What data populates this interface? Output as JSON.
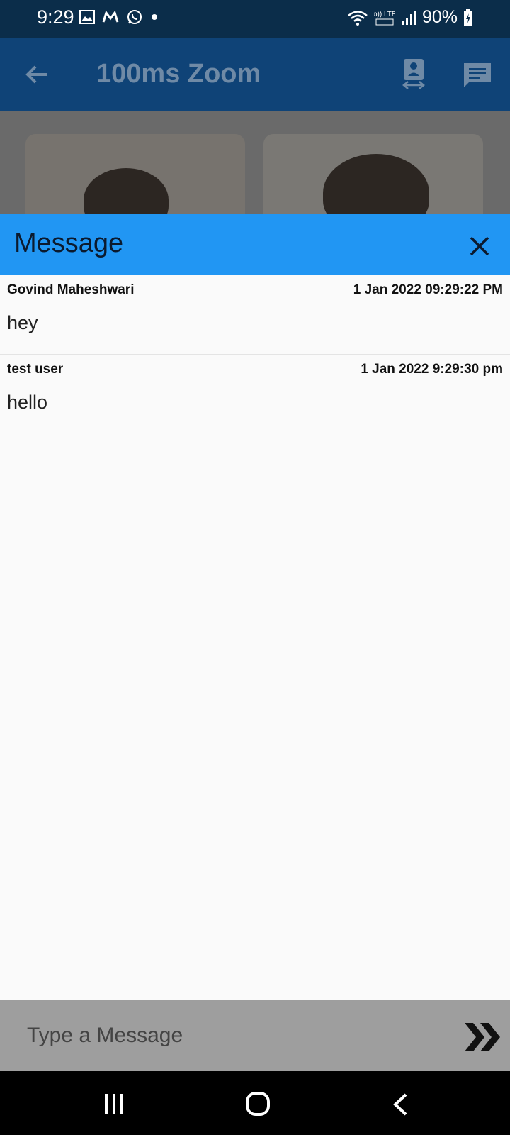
{
  "status_bar": {
    "time": "9:29",
    "battery_percent": "90%",
    "network_label": "Vo)) LTE1",
    "icons_left": [
      "gallery-icon",
      "m-app-icon",
      "whatsapp-icon",
      "dot-icon"
    ],
    "icons_right": [
      "wifi-icon",
      "volte-icon",
      "signal-icon",
      "battery-charging-icon"
    ]
  },
  "app_bar": {
    "title": "100ms Zoom",
    "icons": [
      "back-arrow-icon",
      "switch-camera-icon",
      "chat-icon"
    ]
  },
  "chat_panel": {
    "title": "Message",
    "messages": [
      {
        "sender": "Govind Maheshwari",
        "timestamp": "1 Jan 2022 09:29:22 PM",
        "text": "hey"
      },
      {
        "sender": "test user",
        "timestamp": "1 Jan 2022 9:29:30 pm",
        "text": "hello"
      }
    ]
  },
  "composer": {
    "placeholder": "Type a Message",
    "value": ""
  },
  "nav_bar": {
    "icons": [
      "recents-icon",
      "home-icon",
      "back-icon"
    ]
  },
  "colors": {
    "status_bar": "#0b2d4a",
    "app_bar": "#0f4377",
    "sheet_header": "#2196f3",
    "composer": "#9e9e9e",
    "nav_bar": "#000000"
  }
}
